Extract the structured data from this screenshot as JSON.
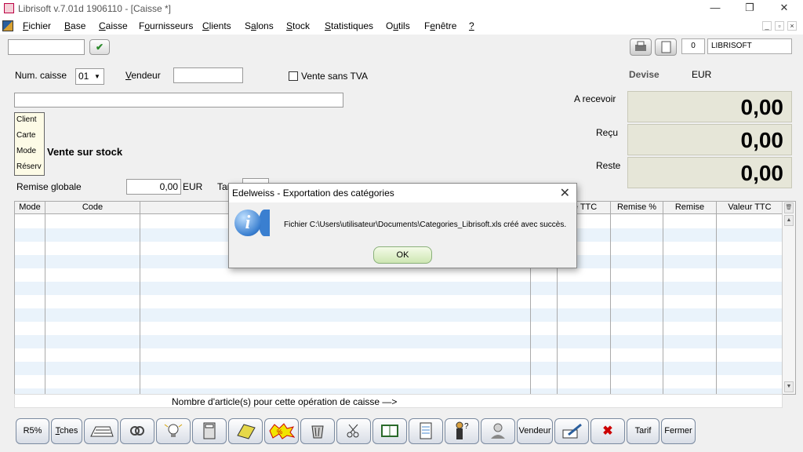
{
  "window": {
    "title": "Librisoft v.7.01d 1906110 - [Caisse *]",
    "minimize": "—",
    "restore": "❐",
    "close": "✕"
  },
  "menu": {
    "items": [
      {
        "pre": "",
        "acc": "F",
        "post": "ichier"
      },
      {
        "pre": "",
        "acc": "B",
        "post": "ase"
      },
      {
        "pre": "",
        "acc": "C",
        "post": "aisse"
      },
      {
        "pre": "F",
        "acc": "o",
        "post": "urnisseurs"
      },
      {
        "pre": "",
        "acc": "C",
        "post": "lients"
      },
      {
        "pre": "S",
        "acc": "a",
        "post": "lons"
      },
      {
        "pre": "",
        "acc": "S",
        "post": "tock"
      },
      {
        "pre": "",
        "acc": "S",
        "post": "tatistiques"
      },
      {
        "pre": "O",
        "acc": "u",
        "post": "tils"
      },
      {
        "pre": "F",
        "acc": "e",
        "post": "nêtre"
      },
      {
        "pre": "",
        "acc": "?",
        "post": ""
      }
    ],
    "mdi_min": "_",
    "mdi_restore": "▫",
    "mdi_close": "×"
  },
  "toolbar": {
    "counter": "0",
    "store": "LIBRISOFT"
  },
  "form": {
    "num_caisse_label": "Num. caisse",
    "num_caisse_value": "01",
    "vendeur_label_acc": "V",
    "vendeur_label_rest": "endeur",
    "vente_sans_tva": "Vente sans TVA",
    "devise_label": "Devise",
    "devise_value": "EUR",
    "client_lines": [
      "Client",
      "Carte",
      "Mode",
      "Réserv"
    ],
    "mode_text": "Vente sur stock",
    "a_recevoir_label": "A recevoir",
    "a_recevoir_value": "0,00",
    "recu_label": "Reçu",
    "recu_value": "0,00",
    "reste_label": "Reste",
    "reste_value": "0,00",
    "remise_globale_label": "Remise globale",
    "remise_globale_value": "0,00",
    "remise_unit": "EUR",
    "tarif_label": "Tarif"
  },
  "grid": {
    "columns": [
      "Mode",
      "Code",
      "",
      "té TTC",
      "Remise %",
      "Remise",
      "Valeur TTC"
    ],
    "count_text": "Nombre d'article(s) pour cette opération de caisse —>"
  },
  "bottom_buttons": {
    "r5": "R5%",
    "tches_acc": "T",
    "tches_rest": "ches",
    "vendeur": "Vendeur",
    "tarif": "Tarif",
    "fermer": "Fermer"
  },
  "dialog": {
    "title": "Edelweiss - Exportation des catégories",
    "message": "Fichier C:\\Users\\utilisateur\\Documents\\Categories_Librisoft.xls créé avec succès.",
    "ok": "OK",
    "icon_glyph": "i"
  },
  "colors": {
    "amount_bg": "#e6e6d8",
    "row_stripe": "#eaf3fb",
    "ok_button": "#cde6b2"
  }
}
